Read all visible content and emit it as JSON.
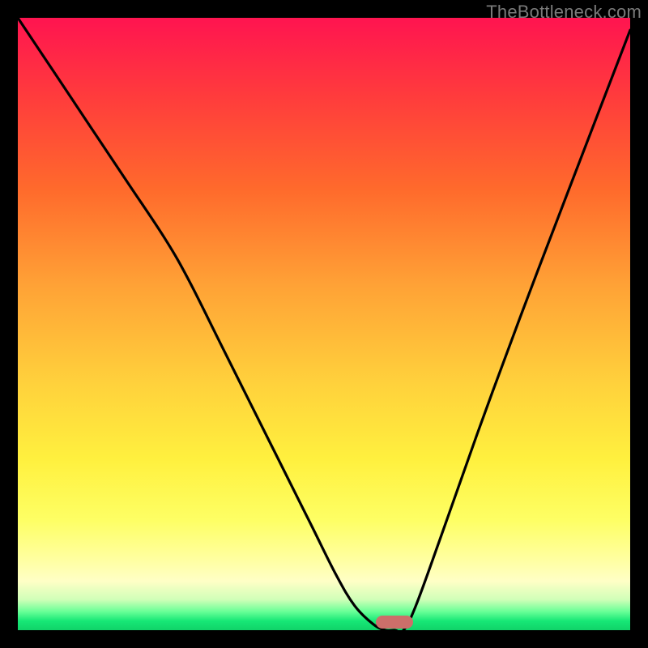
{
  "watermark": "TheBottleneck.com",
  "chart_data": {
    "type": "line",
    "title": "",
    "xlabel": "",
    "ylabel": "",
    "xlim": [
      0,
      100
    ],
    "ylim": [
      0,
      100
    ],
    "grid": false,
    "background": "vertical-gradient red→green",
    "series": [
      {
        "name": "bottleneck-curve",
        "x": [
          0,
          6,
          12,
          18,
          24,
          28,
          33,
          38,
          43,
          48,
          52,
          55,
          58,
          60,
          61.5,
          63,
          65,
          69,
          75,
          82,
          90,
          100
        ],
        "values": [
          100,
          91,
          82,
          73,
          64,
          57,
          47,
          37,
          27,
          17,
          9,
          4,
          1,
          0,
          0,
          0,
          4,
          15,
          32,
          51,
          72,
          98
        ]
      }
    ],
    "marker": {
      "name": "optimal-range",
      "x_start": 58.5,
      "x_end": 64.5,
      "y": 0,
      "color": "#cc6f6a"
    }
  }
}
